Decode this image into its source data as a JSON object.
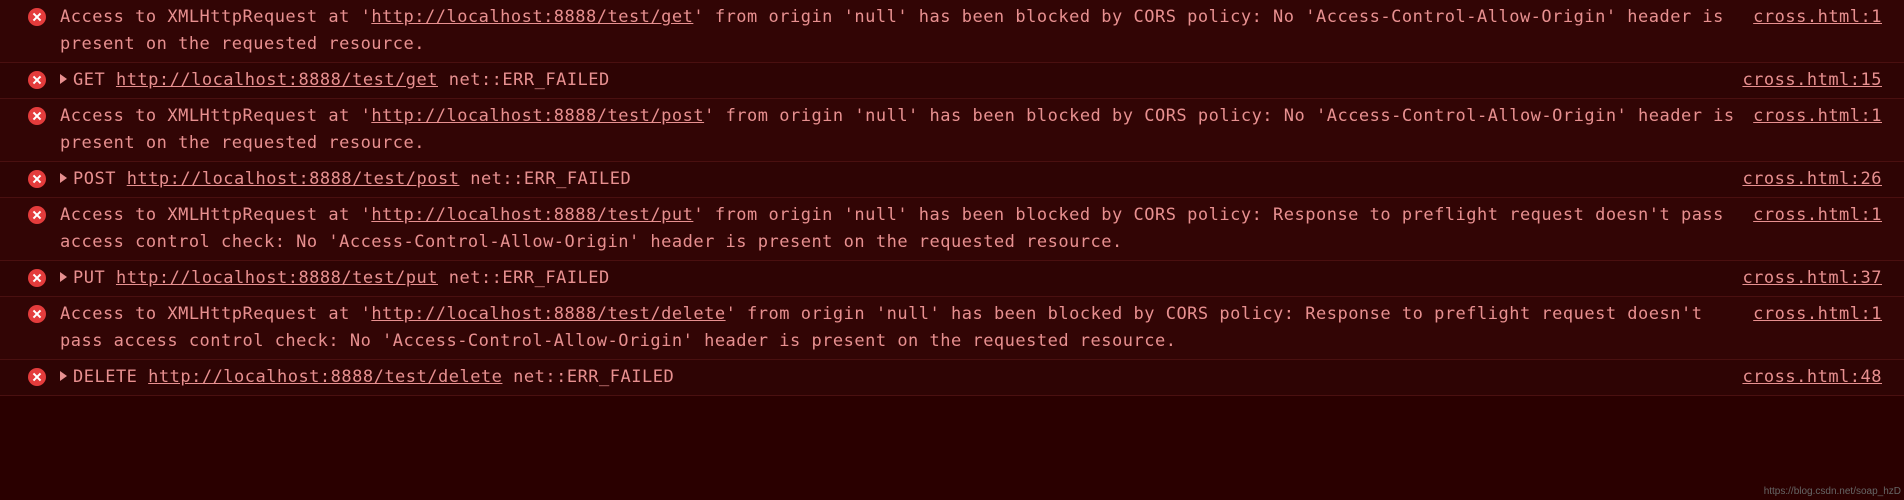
{
  "watermark": "https://blog.csdn.net/soap_hzD",
  "entries": [
    {
      "type": "cors",
      "pre": "Access to XMLHttpRequest at '",
      "url": "http://localhost:8888/test/get",
      "post": "' from origin 'null' has been blocked by CORS policy: No 'Access-Control-Allow-Origin' header is present on the requested resource.",
      "source": "cross.html:1"
    },
    {
      "type": "failed",
      "method": "GET",
      "url": "http://localhost:8888/test/get",
      "tail": " net::ERR_FAILED",
      "source": "cross.html:15"
    },
    {
      "type": "cors",
      "pre": "Access to XMLHttpRequest at '",
      "url": "http://localhost:8888/test/post",
      "post": "' from origin 'null' has been blocked by CORS policy: No 'Access-Control-Allow-Origin' header is present on the requested resource.",
      "source": "cross.html:1"
    },
    {
      "type": "failed",
      "method": "POST",
      "url": "http://localhost:8888/test/post",
      "tail": " net::ERR_FAILED",
      "source": "cross.html:26"
    },
    {
      "type": "cors",
      "pre": "Access to XMLHttpRequest at '",
      "url": "http://localhost:8888/test/put",
      "post": "' from origin 'null' has been blocked by CORS policy: Response to preflight request doesn't pass access control check: No 'Access-Control-Allow-Origin' header is present on the requested resource.",
      "source": "cross.html:1"
    },
    {
      "type": "failed",
      "method": "PUT",
      "url": "http://localhost:8888/test/put",
      "tail": " net::ERR_FAILED",
      "source": "cross.html:37"
    },
    {
      "type": "cors",
      "pre": "Access to XMLHttpRequest at '",
      "url": "http://localhost:8888/test/delete",
      "post": "' from origin 'null' has been blocked by CORS policy: Response to preflight request doesn't pass access control check: No 'Access-Control-Allow-Origin' header is present on the requested resource.",
      "source": "cross.html:1"
    },
    {
      "type": "failed",
      "method": "DELETE",
      "url": "http://localhost:8888/test/delete",
      "tail": " net::ERR_FAILED",
      "source": "cross.html:48"
    }
  ]
}
